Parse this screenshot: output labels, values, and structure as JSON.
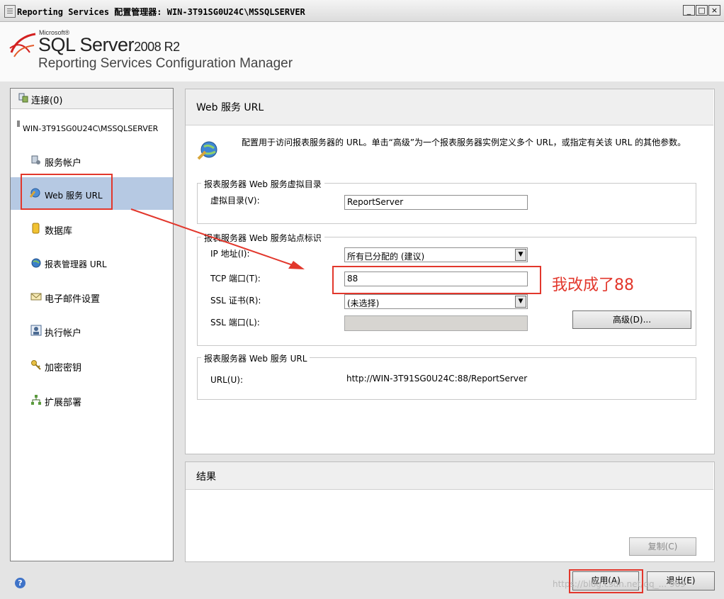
{
  "window": {
    "title": "Reporting Services 配置管理器: WIN-3T91SG0U24C\\MSSQLSERVER",
    "controls": [
      "_",
      "□",
      "×"
    ]
  },
  "header": {
    "vendor": "Microsoft®",
    "product": "SQL Server",
    "version": "2008 R2",
    "subtitle": "Reporting Services Configuration Manager"
  },
  "sidebar": {
    "connect_label": "连接(0)",
    "server": "WIN-3T91SG0U24C\\MSSQLSERVER",
    "items": [
      {
        "label": "服务帐户",
        "icon": "service-account-icon"
      },
      {
        "label": "Web 服务 URL",
        "icon": "web-service-url-icon",
        "selected": true
      },
      {
        "label": "数据库",
        "icon": "database-icon"
      },
      {
        "label": "报表管理器 URL",
        "icon": "globe-icon"
      },
      {
        "label": "电子邮件设置",
        "icon": "email-icon"
      },
      {
        "label": "执行帐户",
        "icon": "execution-account-icon"
      },
      {
        "label": "加密密钥",
        "icon": "key-icon"
      },
      {
        "label": "扩展部署",
        "icon": "scale-out-icon"
      }
    ]
  },
  "main": {
    "title": "Web 服务 URL",
    "description": "配置用于访问报表服务器的 URL。单击“高级”为一个报表服务器实例定义多个 URL，或指定有关该 URL 的其他参数。",
    "virtual_dir_group": {
      "legend": "报表服务器 Web 服务虚拟目录",
      "label": "虚拟目录(V):",
      "value": "ReportServer"
    },
    "site_group": {
      "legend": "报表服务器 Web 服务站点标识",
      "ip_label": "IP 地址(I):",
      "ip_value": "所有已分配的 (建议)",
      "tcp_label": "TCP 端口(T):",
      "tcp_value": "88",
      "ssl_cert_label": "SSL 证书(R):",
      "ssl_cert_value": "(未选择)",
      "ssl_port_label": "SSL 端口(L):",
      "ssl_port_value": "",
      "advanced_button": "高级(D)..."
    },
    "url_group": {
      "legend": "报表服务器 Web 服务 URL",
      "label": "URL(U):",
      "value": "http://WIN-3T91SG0U24C:88/ReportServer"
    }
  },
  "results": {
    "title": "结果",
    "copy_button": "复制(C)"
  },
  "footer": {
    "apply_button": "应用(A)",
    "exit_button": "退出(E)",
    "watermark": "https://blog.csdn.net/qq_... 969"
  },
  "annotation": {
    "text": "我改成了88",
    "color": "#e2372c"
  },
  "colors": {
    "selection": "#b6c9e3",
    "panel_header": "#efefef",
    "workarea": "#e4e4e4"
  }
}
